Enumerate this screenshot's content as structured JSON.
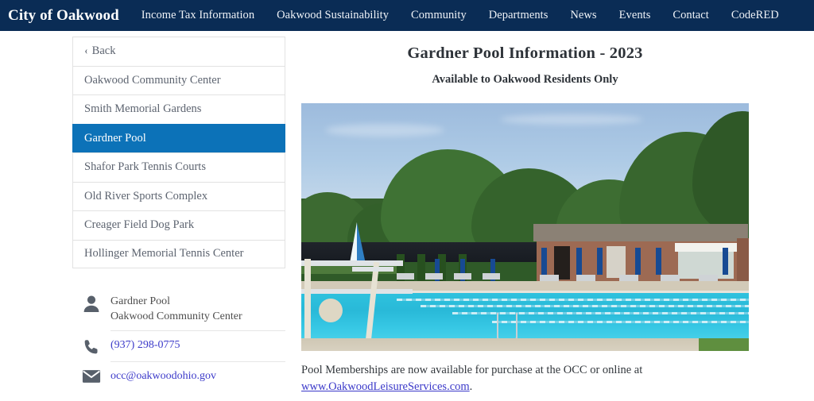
{
  "header": {
    "brand": "City of Oakwood",
    "nav": [
      "Income Tax Information",
      "Oakwood Sustainability",
      "Community",
      "Departments",
      "News",
      "Events",
      "Contact",
      "CodeRED"
    ]
  },
  "sidebar": {
    "back_label": "Back",
    "back_chevron": "‹",
    "items": [
      {
        "label": "Oakwood Community Center",
        "active": false
      },
      {
        "label": "Smith Memorial Gardens",
        "active": false
      },
      {
        "label": "Gardner Pool",
        "active": true
      },
      {
        "label": "Shafor Park Tennis Courts",
        "active": false
      },
      {
        "label": "Old River Sports Complex",
        "active": false
      },
      {
        "label": "Creager Field Dog Park",
        "active": false
      },
      {
        "label": "Hollinger Memorial Tennis Center",
        "active": false
      }
    ]
  },
  "contact": {
    "name_line1": "Gardner Pool",
    "name_line2": "Oakwood Community Center",
    "phone": "(937) 298-0775",
    "email": "occ@oakwoodohio.gov",
    "icons": {
      "person": "person-icon",
      "phone": "phone-icon",
      "email": "envelope-icon"
    }
  },
  "main": {
    "title": "Gardner Pool Information - 2023",
    "subtitle": "Available to Oakwood Residents Only",
    "photo_alt": "Gardner Pool outdoor swimming pool with deck, umbrellas and bathhouse",
    "body_before_link": "Pool Memberships are now available for purchase at the OCC or online at ",
    "body_link": "www.OakwoodLeisureServices.com",
    "body_after_link": "."
  },
  "colors": {
    "nav_navy": "#0a2c55",
    "sidebar_active_blue": "#0c72b8",
    "link_blue": "#3b39c9",
    "pool_cyan": "#2ec2de",
    "icon_slate": "#58606b"
  }
}
